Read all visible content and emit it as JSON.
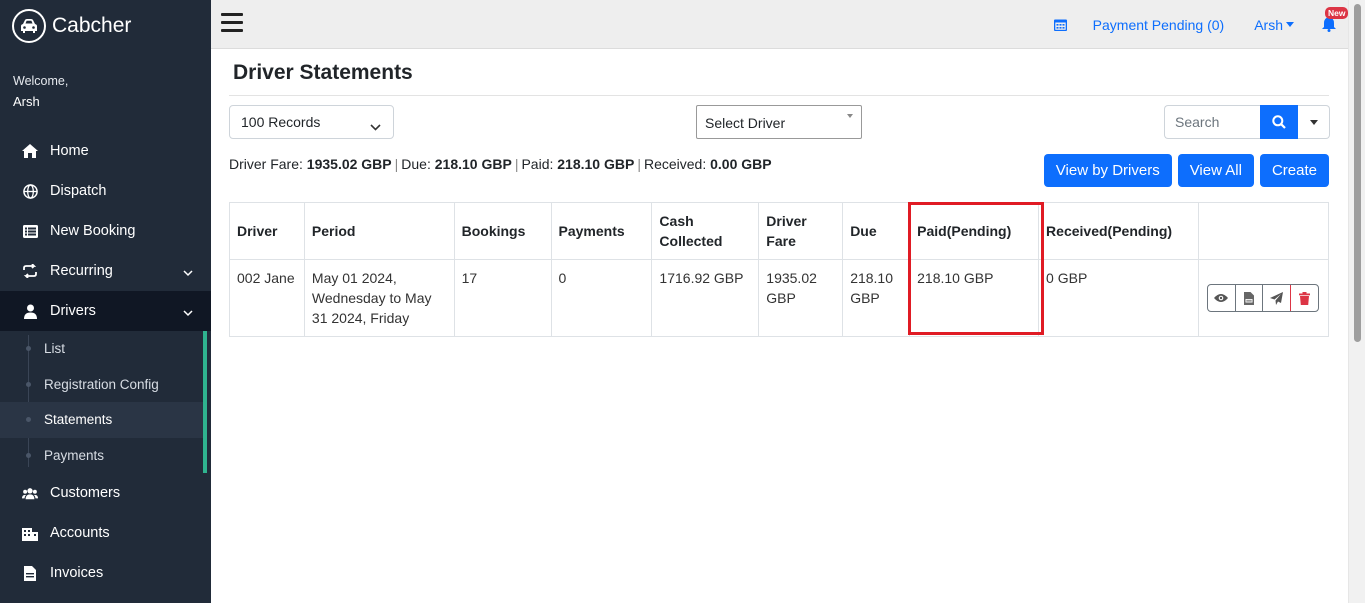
{
  "brand": {
    "name": "Cabcher"
  },
  "sidebar": {
    "welcome": "Welcome,",
    "user": "Arsh",
    "items": [
      {
        "label": "Home",
        "icon": "home-icon"
      },
      {
        "label": "Dispatch",
        "icon": "globe-icon"
      },
      {
        "label": "New Booking",
        "icon": "list-icon"
      },
      {
        "label": "Recurring",
        "icon": "repeat-icon"
      },
      {
        "label": "Drivers",
        "icon": "user-icon"
      },
      {
        "label": "Customers",
        "icon": "users-icon"
      },
      {
        "label": "Accounts",
        "icon": "building-icon"
      },
      {
        "label": "Invoices",
        "icon": "file-icon"
      }
    ],
    "drivers_sub": [
      {
        "label": "List"
      },
      {
        "label": "Registration Config"
      },
      {
        "label": "Statements"
      },
      {
        "label": "Payments"
      }
    ]
  },
  "topbar": {
    "payment_pending": "Payment Pending (0)",
    "user": "Arsh",
    "badge": "New"
  },
  "page": {
    "title": "Driver Statements",
    "records_select": "100 Records",
    "driver_select": "Select Driver",
    "search_placeholder": "Search"
  },
  "summary": {
    "driver_fare_label": "Driver Fare:",
    "driver_fare": "1935.02 GBP",
    "due_label": "Due:",
    "due": "218.10 GBP",
    "paid_label": "Paid:",
    "paid": "218.10 GBP",
    "received_label": "Received:",
    "received": "0.00 GBP"
  },
  "buttons": {
    "view_by_drivers": "View by Drivers",
    "view_all": "View All",
    "create": "Create"
  },
  "table": {
    "headers": [
      "Driver",
      "Period",
      "Bookings",
      "Payments",
      "Cash Collected",
      "Driver Fare",
      "Due",
      "Paid(Pending)",
      "Received(Pending)",
      ""
    ],
    "rows": [
      {
        "driver": "002 Jane",
        "period": "May 01 2024, Wednesday to May 31 2024, Friday",
        "bookings": "17",
        "payments": "0",
        "cash_collected": "1716.92 GBP",
        "driver_fare": "1935.02 GBP",
        "due": "218.10 GBP",
        "paid_pending": "218.10 GBP",
        "received_pending": "0 GBP"
      }
    ]
  },
  "colors": {
    "primary": "#0d6efd",
    "sidebar_bg": "#212b39",
    "accent": "#2fb38f",
    "danger": "#dc3545",
    "highlight": "#e01b24"
  }
}
